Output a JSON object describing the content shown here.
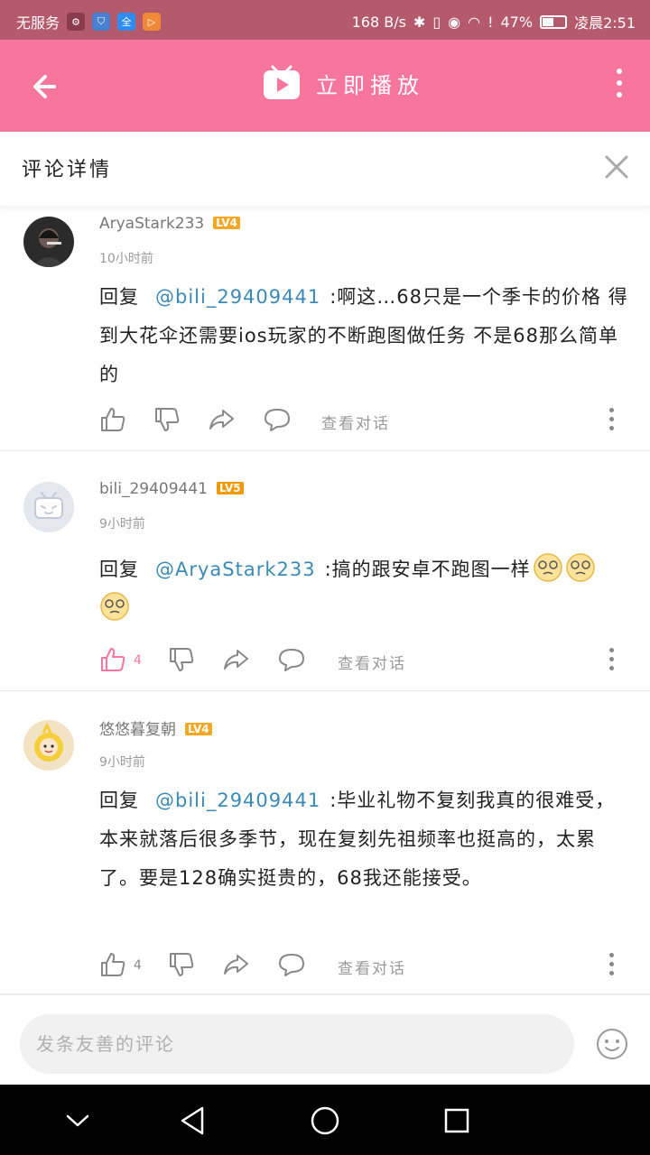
{
  "status_bar": {
    "carrier": "无服务",
    "net_speed": "168 B/s",
    "battery": "47%",
    "time": "凌晨2:51",
    "app_icons": [
      "settings-icon",
      "shield-icon",
      "full-icon",
      "video-icon"
    ]
  },
  "top_bar": {
    "title": "立即播放",
    "back_icon": "back-arrow-icon",
    "more_icon": "more-vertical-icon",
    "accent_color": "#f7769d"
  },
  "panel": {
    "title": "评论详情",
    "close_icon": "close-icon"
  },
  "comments": [
    {
      "username": "AryaStark233",
      "level": "LV4",
      "level_color": "#f5a623",
      "time": "10小时前",
      "reply_word": "回复",
      "mention": "@bili_29409441",
      "content": ":啊这…68只是一个季卡的价格 得到大花伞还需要ios玩家的不断跑图做任务 不是68那么简单的",
      "likes": "",
      "liked": false,
      "view_conversation": "查看对话"
    },
    {
      "username": "bili_29409441",
      "level": "LV5",
      "level_color": "#f39800",
      "time": "9小时前",
      "reply_word": "回复",
      "mention": "@AryaStark233",
      "content": ":搞的跟安卓不跑图一样",
      "emoji_count": 3,
      "likes": "4",
      "liked": true,
      "view_conversation": "查看对话"
    },
    {
      "username": "悠悠暮复朝",
      "level": "LV4",
      "level_color": "#f5a623",
      "time": "9小时前",
      "reply_word": "回复",
      "mention": "@bili_29409441",
      "content": ":毕业礼物不复刻我真的很难受，本来就落后很多季节，现在复刻先祖频率也挺高的，太累了。要是128确实挺贵的，68我还能接受。",
      "likes": "4",
      "liked": false,
      "view_conversation": "查看对话"
    }
  ],
  "input": {
    "placeholder": "发条友善的评论"
  },
  "nav": {
    "icons": [
      "chevron-down-icon",
      "back-triangle-icon",
      "home-circle-icon",
      "recents-square-icon"
    ]
  }
}
